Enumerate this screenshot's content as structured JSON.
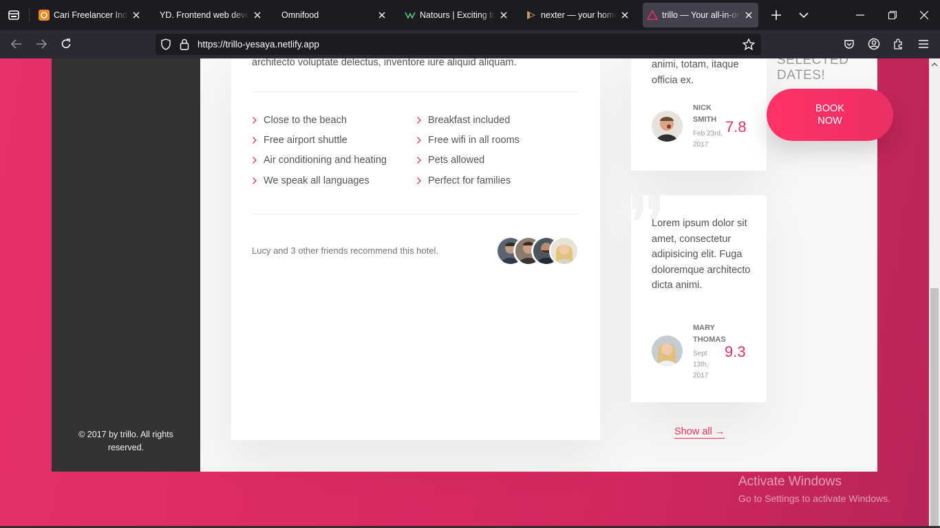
{
  "browser": {
    "tabs": [
      {
        "title": "Cari Freelancer Indonesia",
        "icon": "freelancer-favicon"
      },
      {
        "title": "YD. Frontend web developer",
        "icon": "none"
      },
      {
        "title": "Omnifood",
        "icon": "none"
      },
      {
        "title": "Natours | Exciting tours",
        "icon": "natours-favicon"
      },
      {
        "title": "nexter — your home, your way",
        "icon": "nexter-favicon"
      },
      {
        "title": "trillo — Your all-in-one",
        "icon": "trillo-favicon",
        "active": true
      }
    ],
    "url": "https://trillo-yesaya.netlify.app"
  },
  "page": {
    "description_tail": "architecto voluptate delectus, inventore iure aliquid aliquam.",
    "features": [
      "Close to the beach",
      "Breakfast included",
      "Free airport shuttle",
      "Free wifi in all rooms",
      "Air conditioning and heating",
      "Pets allowed",
      "We speak all languages",
      "Perfect for families"
    ],
    "recommend": "Lucy and 3 other friends recommend this hotel.",
    "sidebar_legal": "© 2017 by trillo. All rights reserved.",
    "reviews": [
      {
        "text": "animi, totam, itaque officia ex.",
        "name_line1": "Nick",
        "name_line2": "Smith",
        "date_line1": "Feb 23rd,",
        "date_line2": "2017",
        "rating": "7.8"
      },
      {
        "text": "Lorem ipsum dolor sit amet, consectetur adipisicing elit. Fuga doloremque architecto dicta animi.",
        "name_line1": "Mary",
        "name_line2": "Thomas",
        "date_line1": "Sept",
        "date_line2": "13th,",
        "date_line3": "2017",
        "rating": "9.3"
      }
    ],
    "show_all": "Show all →",
    "selected_dates": "Selected dates!",
    "book_now_line1": "Book",
    "book_now_line2": "now"
  },
  "windows_watermark": {
    "title": "Activate Windows",
    "subtitle": "Go to Settings to activate Windows."
  },
  "colors": {
    "primary": "#eb2f64",
    "sidebar": "#333333",
    "chrome_dark": "#1c1b22"
  }
}
